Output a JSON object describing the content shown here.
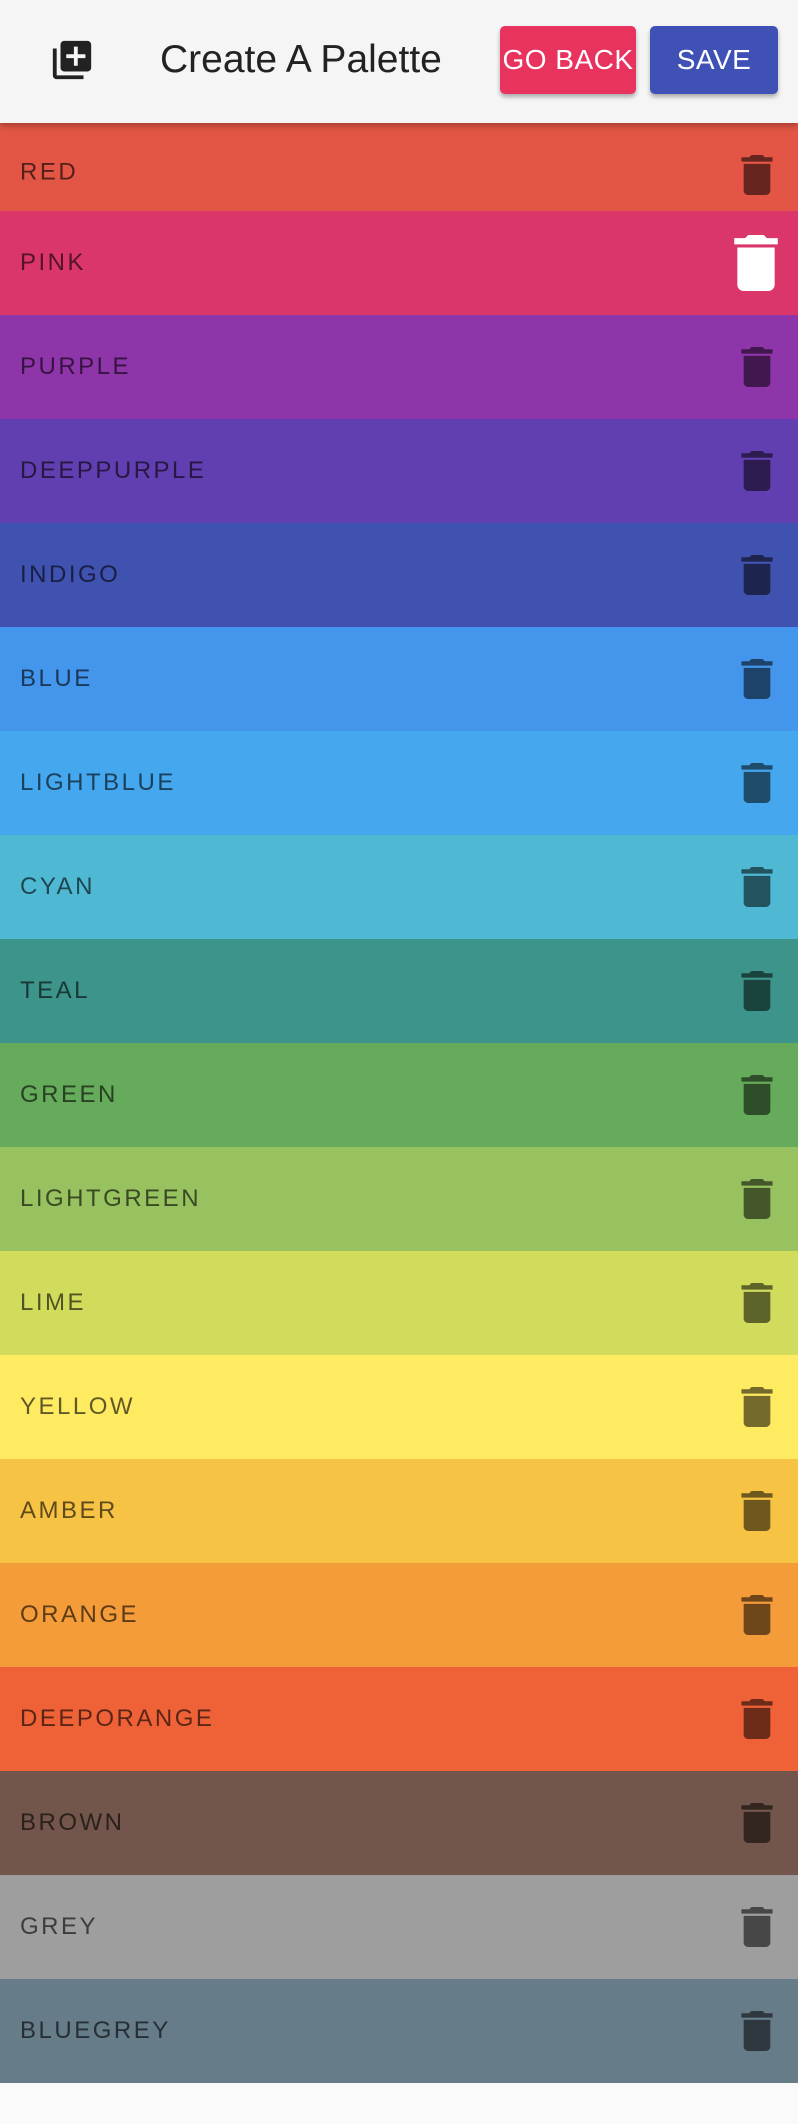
{
  "header": {
    "title": "Create A Palette",
    "go_back_label": "GO BACK",
    "save_label": "SAVE",
    "go_back_color": "#e8335f",
    "save_color": "#3f51b5"
  },
  "colors": [
    {
      "name": "red",
      "color": "#e35645"
    },
    {
      "name": "pink",
      "color": "#db3669"
    },
    {
      "name": "purple",
      "color": "#8e35aa"
    },
    {
      "name": "deeppurple",
      "color": "#623fb0"
    },
    {
      "name": "indigo",
      "color": "#4052b0"
    },
    {
      "name": "blue",
      "color": "#4496ec"
    },
    {
      "name": "lightblue",
      "color": "#45a8ee"
    },
    {
      "name": "cyan",
      "color": "#4fb8d2"
    },
    {
      "name": "teal",
      "color": "#3d948a"
    },
    {
      "name": "green",
      "color": "#66ab5b"
    },
    {
      "name": "lightgreen",
      "color": "#98c15f"
    },
    {
      "name": "lime",
      "color": "#d1dc5c"
    },
    {
      "name": "yellow",
      "color": "#ffeb62"
    },
    {
      "name": "amber",
      "color": "#f7c344"
    },
    {
      "name": "orange",
      "color": "#f49c39"
    },
    {
      "name": "deeporange",
      "color": "#ef6238"
    },
    {
      "name": "brown",
      "color": "#72554b"
    },
    {
      "name": "grey",
      "color": "#9e9e9e"
    },
    {
      "name": "bluegrey",
      "color": "#667c89"
    }
  ],
  "highlighted_index": 1
}
